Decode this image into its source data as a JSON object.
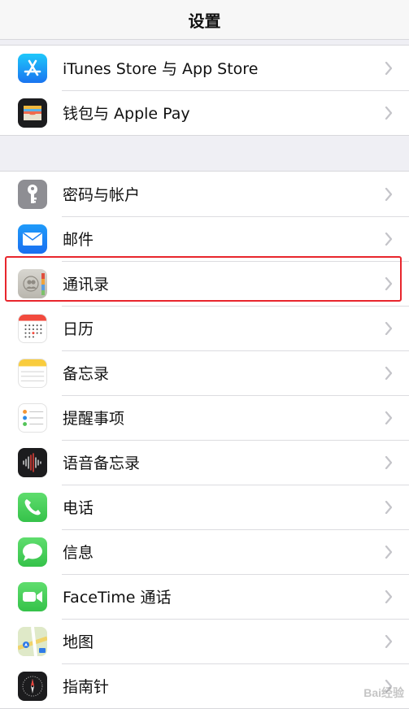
{
  "navbar": {
    "title": "设置"
  },
  "groups": [
    {
      "items": [
        {
          "label": "iTunes Store 与 App Store",
          "icon": "app-store-icon"
        },
        {
          "label": "钱包与 Apple Pay",
          "icon": "wallet-icon"
        }
      ]
    },
    {
      "items": [
        {
          "label": "密码与帐户",
          "icon": "key-icon"
        },
        {
          "label": "邮件",
          "icon": "mail-icon"
        },
        {
          "label": "通讯录",
          "icon": "contacts-icon",
          "highlighted": true
        },
        {
          "label": "日历",
          "icon": "calendar-icon"
        },
        {
          "label": "备忘录",
          "icon": "notes-icon"
        },
        {
          "label": "提醒事项",
          "icon": "reminders-icon"
        },
        {
          "label": "语音备忘录",
          "icon": "voice-memos-icon"
        },
        {
          "label": "电话",
          "icon": "phone-icon"
        },
        {
          "label": "信息",
          "icon": "messages-icon"
        },
        {
          "label": "FaceTime 通话",
          "icon": "facetime-icon"
        },
        {
          "label": "地图",
          "icon": "maps-icon"
        },
        {
          "label": "指南针",
          "icon": "compass-icon"
        }
      ]
    }
  ],
  "highlight_color": "#e8262d",
  "watermark": "Bai经验"
}
